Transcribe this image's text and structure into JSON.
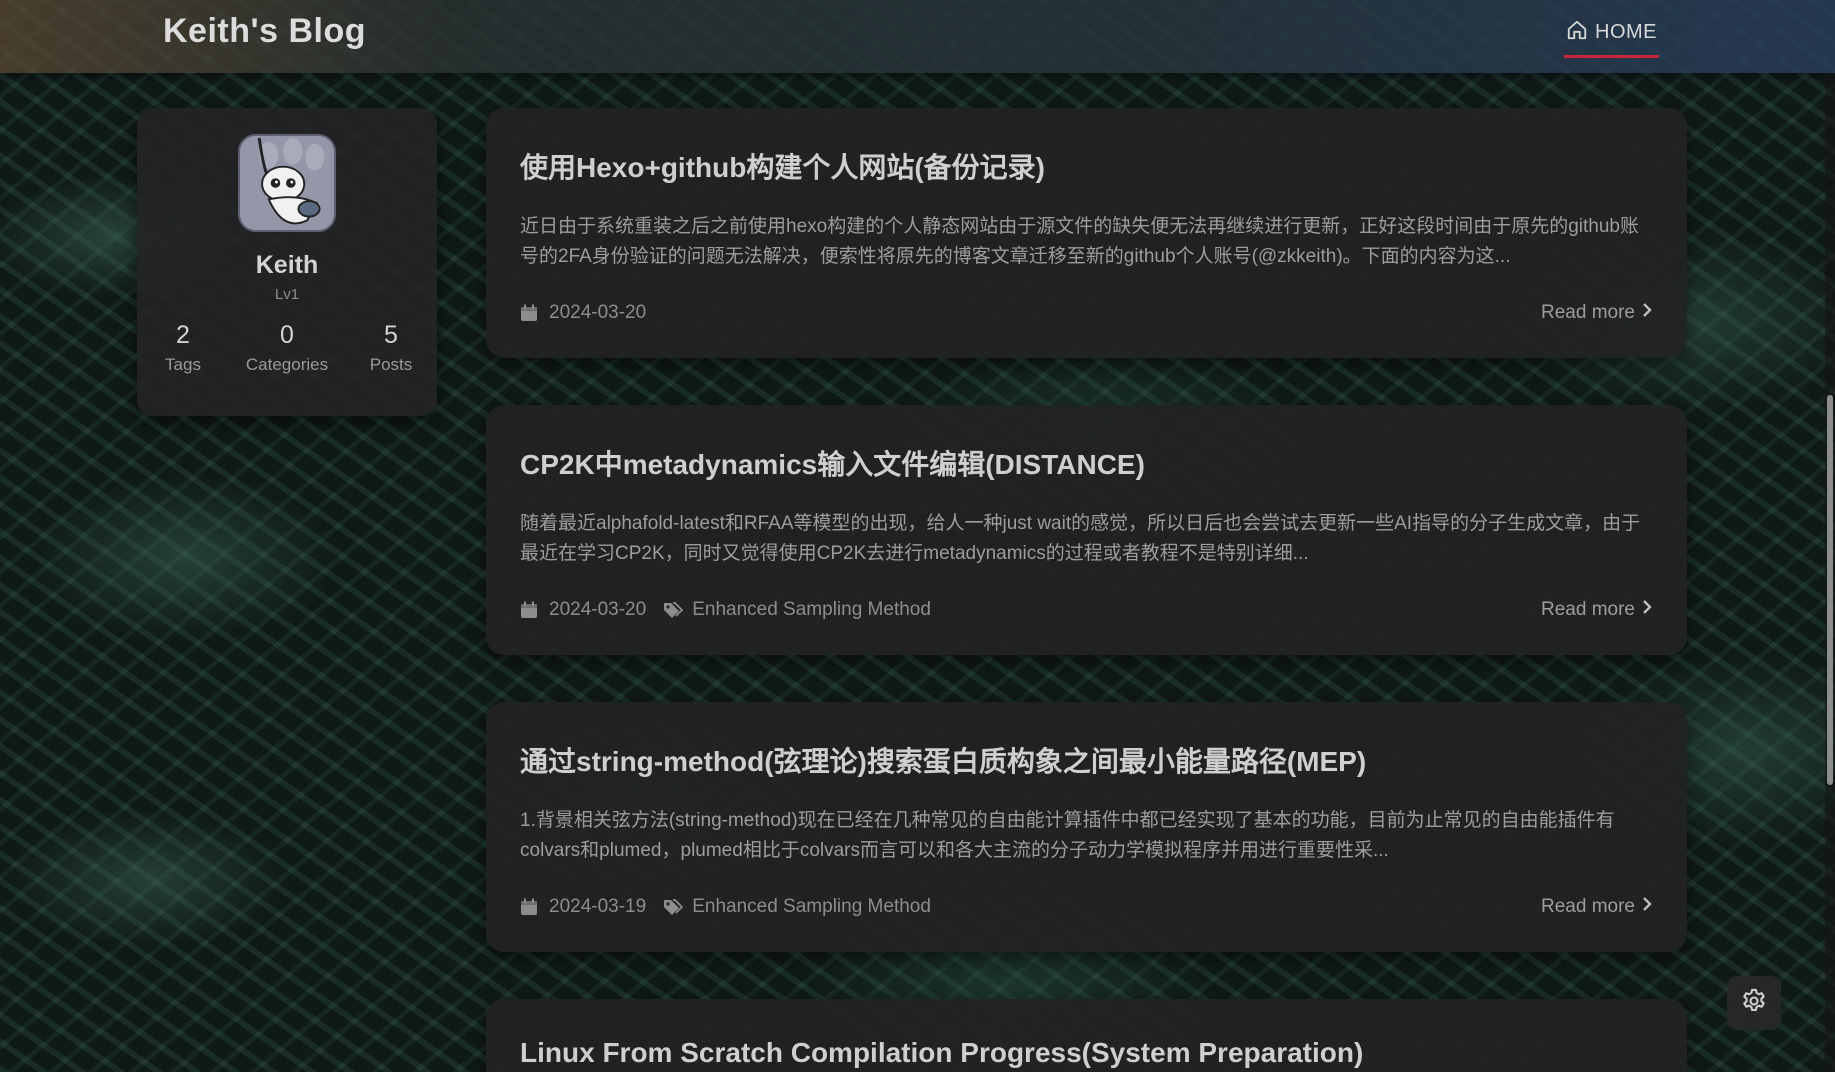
{
  "header": {
    "site_title": "Keith's Blog",
    "nav_home_label": "HOME",
    "accent_color": "#c5283d"
  },
  "profile": {
    "name": "Keith",
    "level": "Lv1",
    "stats": [
      {
        "count": "2",
        "label": "Tags"
      },
      {
        "count": "0",
        "label": "Categories"
      },
      {
        "count": "5",
        "label": "Posts"
      }
    ]
  },
  "posts": [
    {
      "title": "使用Hexo+github构建个人网站(备份记录)",
      "excerpt": "近日由于系统重装之后之前使用hexo构建的个人静态网站由于源文件的缺失便无法再继续进行更新，正好这段时间由于原先的github账号的2FA身份验证的问题无法解决，便索性将原先的博客文章迁移至新的github个人账号(@zkkeith)。下面的内容为这...",
      "date": "2024-03-20",
      "tag": "",
      "read_more": "Read more"
    },
    {
      "title": "CP2K中metadynamics输入文件编辑(DISTANCE)",
      "excerpt": "随着最近alphafold-latest和RFAA等模型的出现，给人一种just wait的感觉，所以日后也会尝试去更新一些AI指导的分子生成文章，由于最近在学习CP2K，同时又觉得使用CP2K去进行metadynamics的过程或者教程不是特别详细...",
      "date": "2024-03-20",
      "tag": "Enhanced Sampling Method",
      "read_more": "Read more"
    },
    {
      "title": "通过string-method(弦理论)搜索蛋白质构象之间最小能量路径(MEP)",
      "excerpt": "1.背景相关弦方法(string-method)现在已经在几种常见的自由能计算插件中都已经实现了基本的功能，目前为止常见的自由能插件有colvars和plumed，plumed相比于colvars而言可以和各大主流的分子动力学模拟程序并用进行重要性采...",
      "date": "2024-03-19",
      "tag": "Enhanced Sampling Method",
      "read_more": "Read more"
    },
    {
      "title": "Linux From Scratch Compilation Progress(System Preparation)"
    }
  ]
}
